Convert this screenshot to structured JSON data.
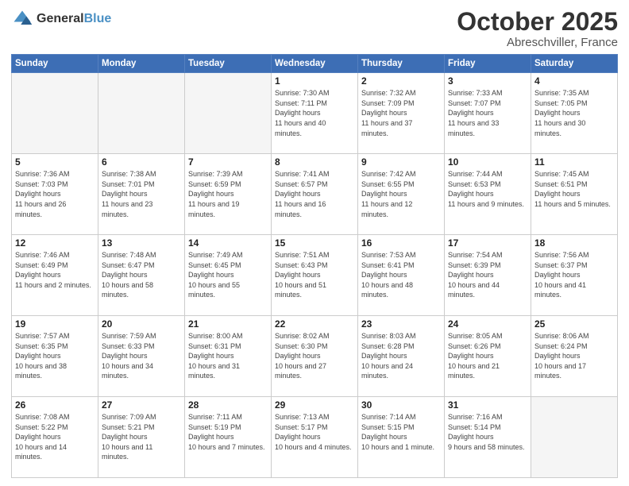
{
  "logo": {
    "general": "General",
    "blue": "Blue"
  },
  "header": {
    "month": "October 2025",
    "location": "Abreschviller, France"
  },
  "weekdays": [
    "Sunday",
    "Monday",
    "Tuesday",
    "Wednesday",
    "Thursday",
    "Friday",
    "Saturday"
  ],
  "weeks": [
    [
      {
        "day": "",
        "empty": true
      },
      {
        "day": "",
        "empty": true
      },
      {
        "day": "",
        "empty": true
      },
      {
        "day": "1",
        "sunrise": "7:30 AM",
        "sunset": "7:11 PM",
        "daylight": "11 hours and 40 minutes."
      },
      {
        "day": "2",
        "sunrise": "7:32 AM",
        "sunset": "7:09 PM",
        "daylight": "11 hours and 37 minutes."
      },
      {
        "day": "3",
        "sunrise": "7:33 AM",
        "sunset": "7:07 PM",
        "daylight": "11 hours and 33 minutes."
      },
      {
        "day": "4",
        "sunrise": "7:35 AM",
        "sunset": "7:05 PM",
        "daylight": "11 hours and 30 minutes."
      }
    ],
    [
      {
        "day": "5",
        "sunrise": "7:36 AM",
        "sunset": "7:03 PM",
        "daylight": "11 hours and 26 minutes."
      },
      {
        "day": "6",
        "sunrise": "7:38 AM",
        "sunset": "7:01 PM",
        "daylight": "11 hours and 23 minutes."
      },
      {
        "day": "7",
        "sunrise": "7:39 AM",
        "sunset": "6:59 PM",
        "daylight": "11 hours and 19 minutes."
      },
      {
        "day": "8",
        "sunrise": "7:41 AM",
        "sunset": "6:57 PM",
        "daylight": "11 hours and 16 minutes."
      },
      {
        "day": "9",
        "sunrise": "7:42 AM",
        "sunset": "6:55 PM",
        "daylight": "11 hours and 12 minutes."
      },
      {
        "day": "10",
        "sunrise": "7:44 AM",
        "sunset": "6:53 PM",
        "daylight": "11 hours and 9 minutes."
      },
      {
        "day": "11",
        "sunrise": "7:45 AM",
        "sunset": "6:51 PM",
        "daylight": "11 hours and 5 minutes."
      }
    ],
    [
      {
        "day": "12",
        "sunrise": "7:46 AM",
        "sunset": "6:49 PM",
        "daylight": "11 hours and 2 minutes."
      },
      {
        "day": "13",
        "sunrise": "7:48 AM",
        "sunset": "6:47 PM",
        "daylight": "10 hours and 58 minutes."
      },
      {
        "day": "14",
        "sunrise": "7:49 AM",
        "sunset": "6:45 PM",
        "daylight": "10 hours and 55 minutes."
      },
      {
        "day": "15",
        "sunrise": "7:51 AM",
        "sunset": "6:43 PM",
        "daylight": "10 hours and 51 minutes."
      },
      {
        "day": "16",
        "sunrise": "7:53 AM",
        "sunset": "6:41 PM",
        "daylight": "10 hours and 48 minutes."
      },
      {
        "day": "17",
        "sunrise": "7:54 AM",
        "sunset": "6:39 PM",
        "daylight": "10 hours and 44 minutes."
      },
      {
        "day": "18",
        "sunrise": "7:56 AM",
        "sunset": "6:37 PM",
        "daylight": "10 hours and 41 minutes."
      }
    ],
    [
      {
        "day": "19",
        "sunrise": "7:57 AM",
        "sunset": "6:35 PM",
        "daylight": "10 hours and 38 minutes."
      },
      {
        "day": "20",
        "sunrise": "7:59 AM",
        "sunset": "6:33 PM",
        "daylight": "10 hours and 34 minutes."
      },
      {
        "day": "21",
        "sunrise": "8:00 AM",
        "sunset": "6:31 PM",
        "daylight": "10 hours and 31 minutes."
      },
      {
        "day": "22",
        "sunrise": "8:02 AM",
        "sunset": "6:30 PM",
        "daylight": "10 hours and 27 minutes."
      },
      {
        "day": "23",
        "sunrise": "8:03 AM",
        "sunset": "6:28 PM",
        "daylight": "10 hours and 24 minutes."
      },
      {
        "day": "24",
        "sunrise": "8:05 AM",
        "sunset": "6:26 PM",
        "daylight": "10 hours and 21 minutes."
      },
      {
        "day": "25",
        "sunrise": "8:06 AM",
        "sunset": "6:24 PM",
        "daylight": "10 hours and 17 minutes."
      }
    ],
    [
      {
        "day": "26",
        "sunrise": "7:08 AM",
        "sunset": "5:22 PM",
        "daylight": "10 hours and 14 minutes."
      },
      {
        "day": "27",
        "sunrise": "7:09 AM",
        "sunset": "5:21 PM",
        "daylight": "10 hours and 11 minutes."
      },
      {
        "day": "28",
        "sunrise": "7:11 AM",
        "sunset": "5:19 PM",
        "daylight": "10 hours and 7 minutes."
      },
      {
        "day": "29",
        "sunrise": "7:13 AM",
        "sunset": "5:17 PM",
        "daylight": "10 hours and 4 minutes."
      },
      {
        "day": "30",
        "sunrise": "7:14 AM",
        "sunset": "5:15 PM",
        "daylight": "10 hours and 1 minute."
      },
      {
        "day": "31",
        "sunrise": "7:16 AM",
        "sunset": "5:14 PM",
        "daylight": "9 hours and 58 minutes."
      },
      {
        "day": "",
        "empty": true
      }
    ]
  ],
  "labels": {
    "sunrise": "Sunrise:",
    "sunset": "Sunset:",
    "daylight": "Daylight hours"
  }
}
